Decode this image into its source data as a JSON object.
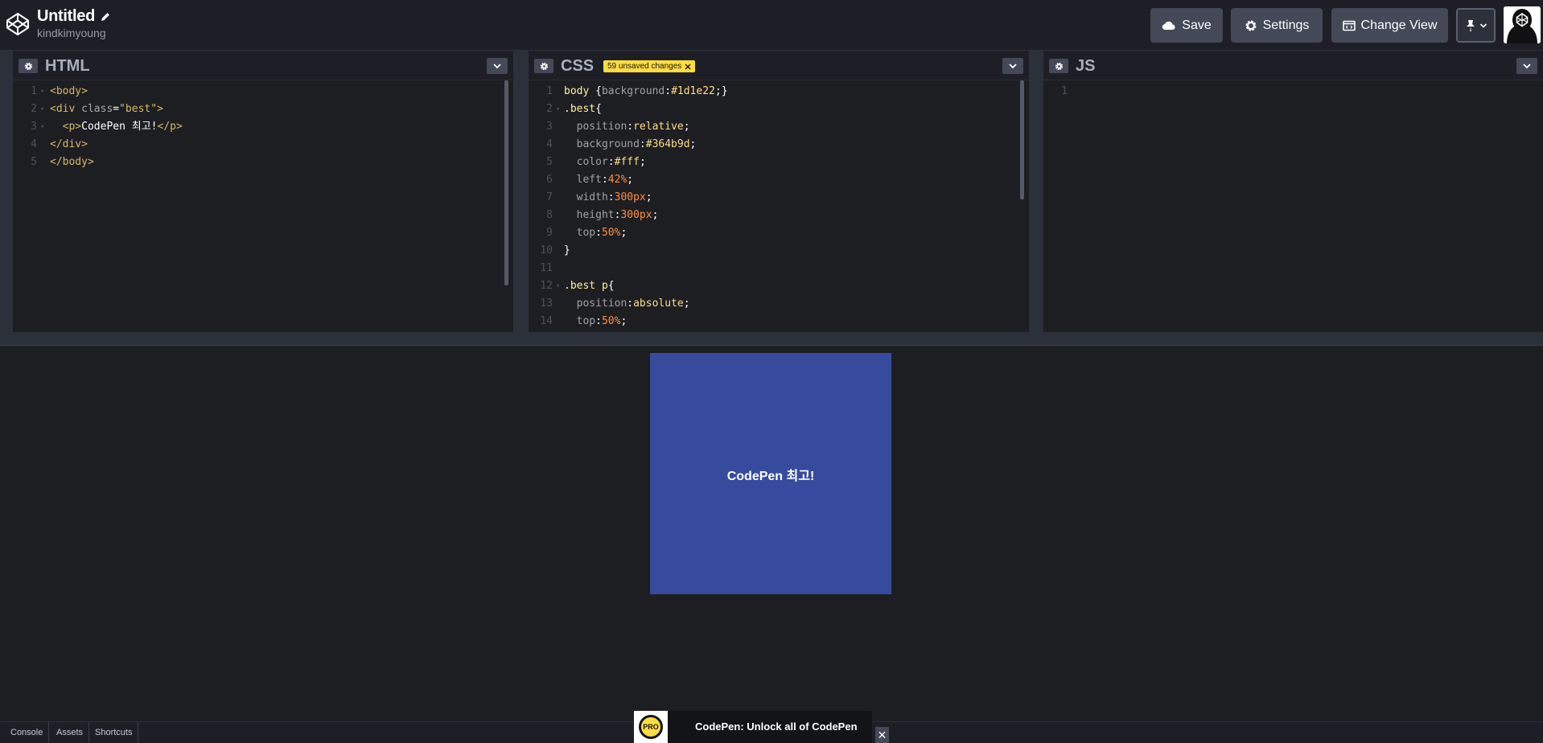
{
  "header": {
    "title": "Untitled",
    "owner": "kindkimyoung",
    "save_label": "Save",
    "settings_label": "Settings",
    "change_view_label": "Change View"
  },
  "editors": {
    "html": {
      "title": "HTML",
      "lines": [
        {
          "n": "1",
          "parts": [
            {
              "t": "<body>",
              "c": "t-tag"
            }
          ]
        },
        {
          "n": "2",
          "parts": [
            {
              "t": "<div ",
              "c": "t-tag"
            },
            {
              "t": "class",
              "c": "t-attr"
            },
            {
              "t": "=",
              "c": "t-text"
            },
            {
              "t": "\"best\"",
              "c": "t-str"
            },
            {
              "t": ">",
              "c": "t-tag"
            }
          ]
        },
        {
          "n": "3",
          "parts": [
            {
              "t": "  <p>",
              "c": "t-tag"
            },
            {
              "t": "CodePen 최고!",
              "c": "t-text"
            },
            {
              "t": "</p>",
              "c": "t-tag"
            }
          ]
        },
        {
          "n": "4",
          "parts": [
            {
              "t": "</div>",
              "c": "t-tag"
            }
          ]
        },
        {
          "n": "5",
          "parts": [
            {
              "t": "</body>",
              "c": "t-tag"
            }
          ]
        }
      ]
    },
    "css": {
      "title": "CSS",
      "unsaved_label": "59 unsaved changes",
      "lines": [
        {
          "n": "1",
          "parts": [
            {
              "t": "body ",
              "c": "t-sel"
            },
            {
              "t": "{",
              "c": "t-brace"
            },
            {
              "t": "background",
              "c": "t-prop"
            },
            {
              "t": ":",
              "c": "t-text"
            },
            {
              "t": "#1d1e22",
              "c": "t-val"
            },
            {
              "t": ";}",
              "c": "t-brace"
            }
          ]
        },
        {
          "n": "2",
          "parts": [
            {
              "t": ".best",
              "c": "t-sel"
            },
            {
              "t": "{",
              "c": "t-brace"
            }
          ]
        },
        {
          "n": "3",
          "parts": [
            {
              "t": "  position",
              "c": "t-prop"
            },
            {
              "t": ":",
              "c": "t-text"
            },
            {
              "t": "relative",
              "c": "t-val"
            },
            {
              "t": ";",
              "c": "t-text"
            }
          ]
        },
        {
          "n": "4",
          "parts": [
            {
              "t": "  background",
              "c": "t-prop"
            },
            {
              "t": ":",
              "c": "t-text"
            },
            {
              "t": "#364b9d",
              "c": "t-val"
            },
            {
              "t": ";",
              "c": "t-text"
            }
          ]
        },
        {
          "n": "5",
          "parts": [
            {
              "t": "  color",
              "c": "t-prop"
            },
            {
              "t": ":",
              "c": "t-text"
            },
            {
              "t": "#fff",
              "c": "t-val"
            },
            {
              "t": ";",
              "c": "t-text"
            }
          ]
        },
        {
          "n": "6",
          "parts": [
            {
              "t": "  left",
              "c": "t-prop"
            },
            {
              "t": ":",
              "c": "t-text"
            },
            {
              "t": "42%",
              "c": "t-num"
            },
            {
              "t": ";",
              "c": "t-text"
            }
          ]
        },
        {
          "n": "7",
          "parts": [
            {
              "t": "  width",
              "c": "t-prop"
            },
            {
              "t": ":",
              "c": "t-text"
            },
            {
              "t": "300px",
              "c": "t-num"
            },
            {
              "t": ";",
              "c": "t-text"
            }
          ]
        },
        {
          "n": "8",
          "parts": [
            {
              "t": "  height",
              "c": "t-prop"
            },
            {
              "t": ":",
              "c": "t-text"
            },
            {
              "t": "300px",
              "c": "t-num"
            },
            {
              "t": ";",
              "c": "t-text"
            }
          ]
        },
        {
          "n": "9",
          "parts": [
            {
              "t": "  top",
              "c": "t-prop"
            },
            {
              "t": ":",
              "c": "t-text"
            },
            {
              "t": "50%",
              "c": "t-num"
            },
            {
              "t": ";",
              "c": "t-text"
            }
          ]
        },
        {
          "n": "10",
          "parts": [
            {
              "t": "}",
              "c": "t-brace"
            }
          ]
        },
        {
          "n": "11",
          "parts": []
        },
        {
          "n": "12",
          "parts": [
            {
              "t": ".best p",
              "c": "t-sel"
            },
            {
              "t": "{",
              "c": "t-brace"
            }
          ]
        },
        {
          "n": "13",
          "parts": [
            {
              "t": "  position",
              "c": "t-prop"
            },
            {
              "t": ":",
              "c": "t-text"
            },
            {
              "t": "absolute",
              "c": "t-val"
            },
            {
              "t": ";",
              "c": "t-text"
            }
          ]
        },
        {
          "n": "14",
          "parts": [
            {
              "t": "  top",
              "c": "t-prop"
            },
            {
              "t": ":",
              "c": "t-text"
            },
            {
              "t": "50%",
              "c": "t-num"
            },
            {
              "t": ";",
              "c": "t-text"
            }
          ]
        }
      ]
    },
    "js": {
      "title": "JS",
      "lines": [
        {
          "n": "1",
          "parts": []
        }
      ]
    }
  },
  "preview": {
    "box_text": "CodePen 최고!",
    "box_color": "#364b9d",
    "background": "#1d1e22"
  },
  "footer": {
    "console_label": "Console",
    "assets_label": "Assets",
    "shortcuts_label": "Shortcuts"
  },
  "promo": {
    "badge": "PRO",
    "text": "CodePen: Unlock all of CodePen",
    "close_label": "✕"
  },
  "colors": {
    "accent_badge": "#ffdd40",
    "button_bg": "#444857"
  }
}
